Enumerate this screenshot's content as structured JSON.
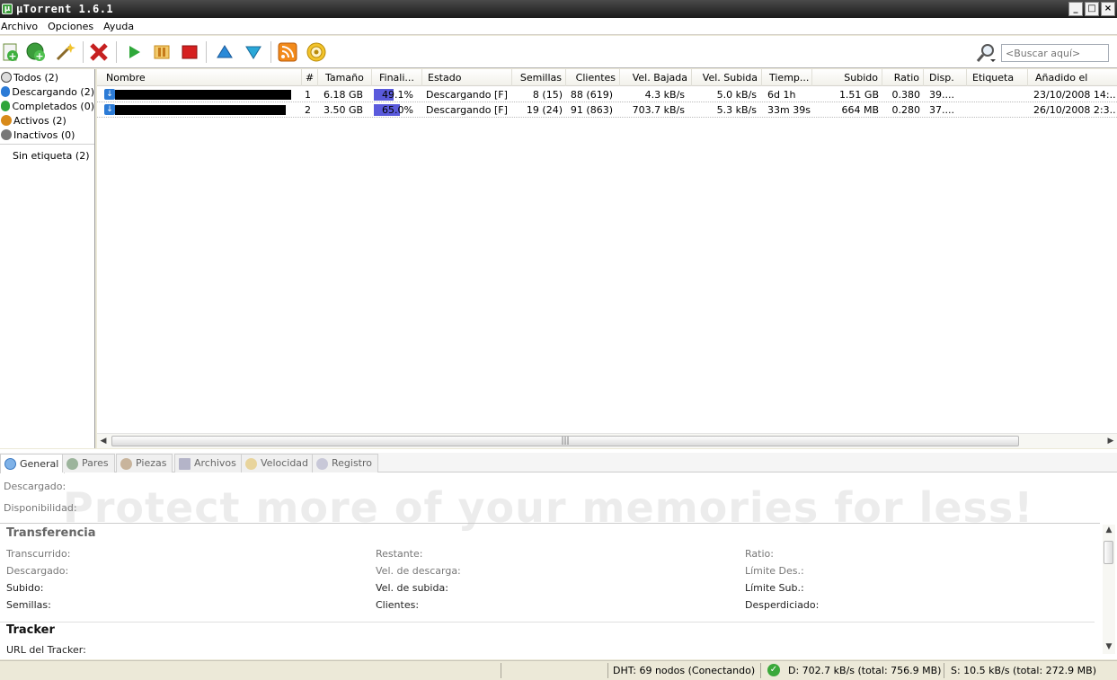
{
  "window": {
    "title": "µTorrent 1.6.1"
  },
  "menu": [
    "Archivo",
    "Opciones",
    "Ayuda"
  ],
  "toolbar": {
    "search_placeholder": "<Buscar aquí>",
    "icons": [
      "add-torrent-icon",
      "add-url-icon",
      "create-torrent-icon",
      "remove-icon",
      "start-icon",
      "pause-icon",
      "stop-icon",
      "move-up-icon",
      "move-down-icon",
      "rss-icon",
      "preferences-icon",
      "search-icon"
    ]
  },
  "sidebar": {
    "items": [
      {
        "label": "Todos (2)",
        "color": "#444444"
      },
      {
        "label": "Descargando (2)",
        "color": "#2c7bd6"
      },
      {
        "label": "Completados (0)",
        "color": "#2fa53a"
      },
      {
        "label": "Activos (2)",
        "color": "#d88a1a"
      },
      {
        "label": "Inactivos (0)",
        "color": "#777777"
      }
    ],
    "labels": [
      {
        "label": "Sin etiqueta (2)"
      }
    ]
  },
  "torrents": {
    "columns": [
      "Nombre",
      "#",
      "Tamaño",
      "Finali...",
      "Estado",
      "Semillas",
      "Clientes",
      "Vel. Bajada",
      "Vel. Subida",
      "Tiemp...",
      "Subido",
      "Ratio",
      "Disp.",
      "Etiqueta",
      "Añadido el"
    ],
    "rows": [
      {
        "num": "1",
        "size": "6.18 GB",
        "progress": 49.1,
        "progress_text": "49.1%",
        "status": "Descargando [F]",
        "seeds": "8 (15)",
        "peers": "88 (619)",
        "down": "4.3 kB/s",
        "up": "5.0 kB/s",
        "eta": "6d 1h",
        "uploaded": "1.51 GB",
        "ratio": "0.380",
        "avail": "39....",
        "label": "",
        "added": "23/10/2008 14:..."
      },
      {
        "num": "2",
        "size": "3.50 GB",
        "progress": 65.0,
        "progress_text": "65.0%",
        "status": "Descargando [F]",
        "seeds": "19 (24)",
        "peers": "91 (863)",
        "down": "703.7 kB/s",
        "up": "5.3 kB/s",
        "eta": "33m 39s",
        "uploaded": "664 MB",
        "ratio": "0.280",
        "avail": "37....",
        "label": "",
        "added": "26/10/2008 2:3..."
      }
    ],
    "progress_color": "#5a5adc"
  },
  "detail": {
    "tabs": [
      "General",
      "Pares",
      "Piezas",
      "Archivos",
      "Velocidad",
      "Registro"
    ],
    "downloaded_label": "Descargado:",
    "availability_label": "Disponibilidad:",
    "watermark": "Protect more of your memories for less!",
    "transfer": {
      "title": "Transferencia",
      "col1": [
        "Transcurrido:",
        "Descargado:",
        "Subido:",
        "Semillas:"
      ],
      "col2": [
        "Restante:",
        "Vel. de descarga:",
        "Vel. de subida:",
        "Clientes:"
      ],
      "col3": [
        "Ratio:",
        "Límite Des.:",
        "Límite Sub.:",
        "Desperdiciado:"
      ]
    },
    "tracker": {
      "title": "Tracker",
      "url_label": "URL del Tracker:"
    }
  },
  "statusbar": {
    "dht": "DHT: 69 nodos (Conectando)",
    "download": "D: 702.7 kB/s  (total: 756.9 MB)",
    "upload": "S: 10.5 kB/s  (total: 272.9 MB)"
  }
}
